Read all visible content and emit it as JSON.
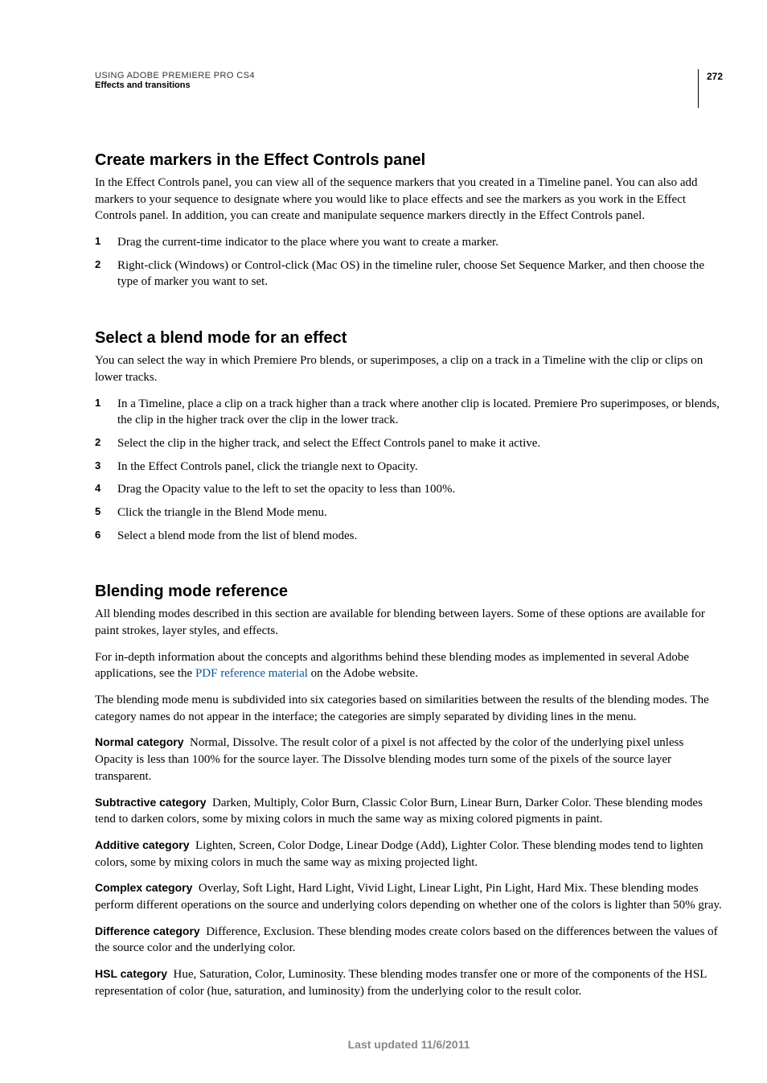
{
  "header": {
    "title": "USING ADOBE PREMIERE PRO CS4",
    "subtitle": "Effects and transitions",
    "page_number": "272"
  },
  "section1": {
    "heading": "Create markers in the Effect Controls panel",
    "intro": "In the Effect Controls panel, you can view all of the sequence markers that you created in a Timeline panel. You can also add markers to your sequence to designate where you would like to place effects and see the markers as you work in the Effect Controls panel. In addition, you can create and manipulate sequence markers directly in the Effect Controls panel.",
    "steps": [
      "Drag the current-time indicator to the place where you want to create a marker.",
      "Right-click (Windows) or Control-click (Mac OS) in the timeline ruler, choose Set Sequence Marker, and then choose the type of marker you want to set."
    ]
  },
  "section2": {
    "heading": "Select a blend mode for an effect",
    "intro": "You can select the way in which Premiere Pro blends, or superimposes, a clip on a track in a Timeline with the clip or clips on lower tracks.",
    "steps": [
      "In a Timeline, place a clip on a track higher than a track where another clip is located. Premiere Pro superimposes, or blends, the clip in the higher track over the clip in the lower track.",
      "Select the clip in the higher track, and select the Effect Controls panel to make it active.",
      "In the Effect Controls panel, click the triangle next to Opacity.",
      "Drag the Opacity value to the left to set the opacity to less than 100%.",
      "Click the triangle in the Blend Mode menu.",
      "Select a blend mode from the list of blend modes."
    ]
  },
  "section3": {
    "heading": "Blending mode reference",
    "p1": "All blending modes described in this section are available for blending between layers. Some of these options are available for paint strokes, layer styles, and effects.",
    "p2_before": "For in-depth information about the concepts and algorithms behind these blending modes as implemented in several Adobe applications, see the ",
    "p2_link": "PDF reference material",
    "p2_after": " on the Adobe website.",
    "p3": "The blending mode menu is subdivided into six categories based on similarities between the results of the blending modes. The category names do not appear in the interface; the categories are simply separated by dividing lines in the menu.",
    "categories": [
      {
        "label": "Normal category",
        "body": "Normal, Dissolve. The result color of a pixel is not affected by the color of the underlying pixel unless Opacity is less than 100% for the source layer. The Dissolve blending modes turn some of the pixels of the source layer transparent."
      },
      {
        "label": "Subtractive category",
        "body": "Darken, Multiply, Color Burn, Classic Color Burn, Linear Burn, Darker Color. These blending modes tend to darken colors, some by mixing colors in much the same way as mixing colored pigments in paint."
      },
      {
        "label": "Additive category",
        "body": "Lighten, Screen, Color Dodge, Linear Dodge (Add), Lighter Color. These blending modes tend to lighten colors, some by mixing colors in much the same way as mixing projected light."
      },
      {
        "label": "Complex category",
        "body": "Overlay, Soft Light, Hard Light, Vivid Light, Linear Light, Pin Light, Hard Mix. These blending modes perform different operations on the source and underlying colors depending on whether one of the colors is lighter than 50% gray."
      },
      {
        "label": "Difference category",
        "body": "Difference, Exclusion. These blending modes create colors based on the differences between the values of the source color and the underlying color."
      },
      {
        "label": "HSL category",
        "body": "Hue, Saturation, Color, Luminosity. These blending modes transfer one or more of the components of the HSL representation of color (hue, saturation, and luminosity) from the underlying color to the result color."
      }
    ]
  },
  "footer": "Last updated 11/6/2011"
}
